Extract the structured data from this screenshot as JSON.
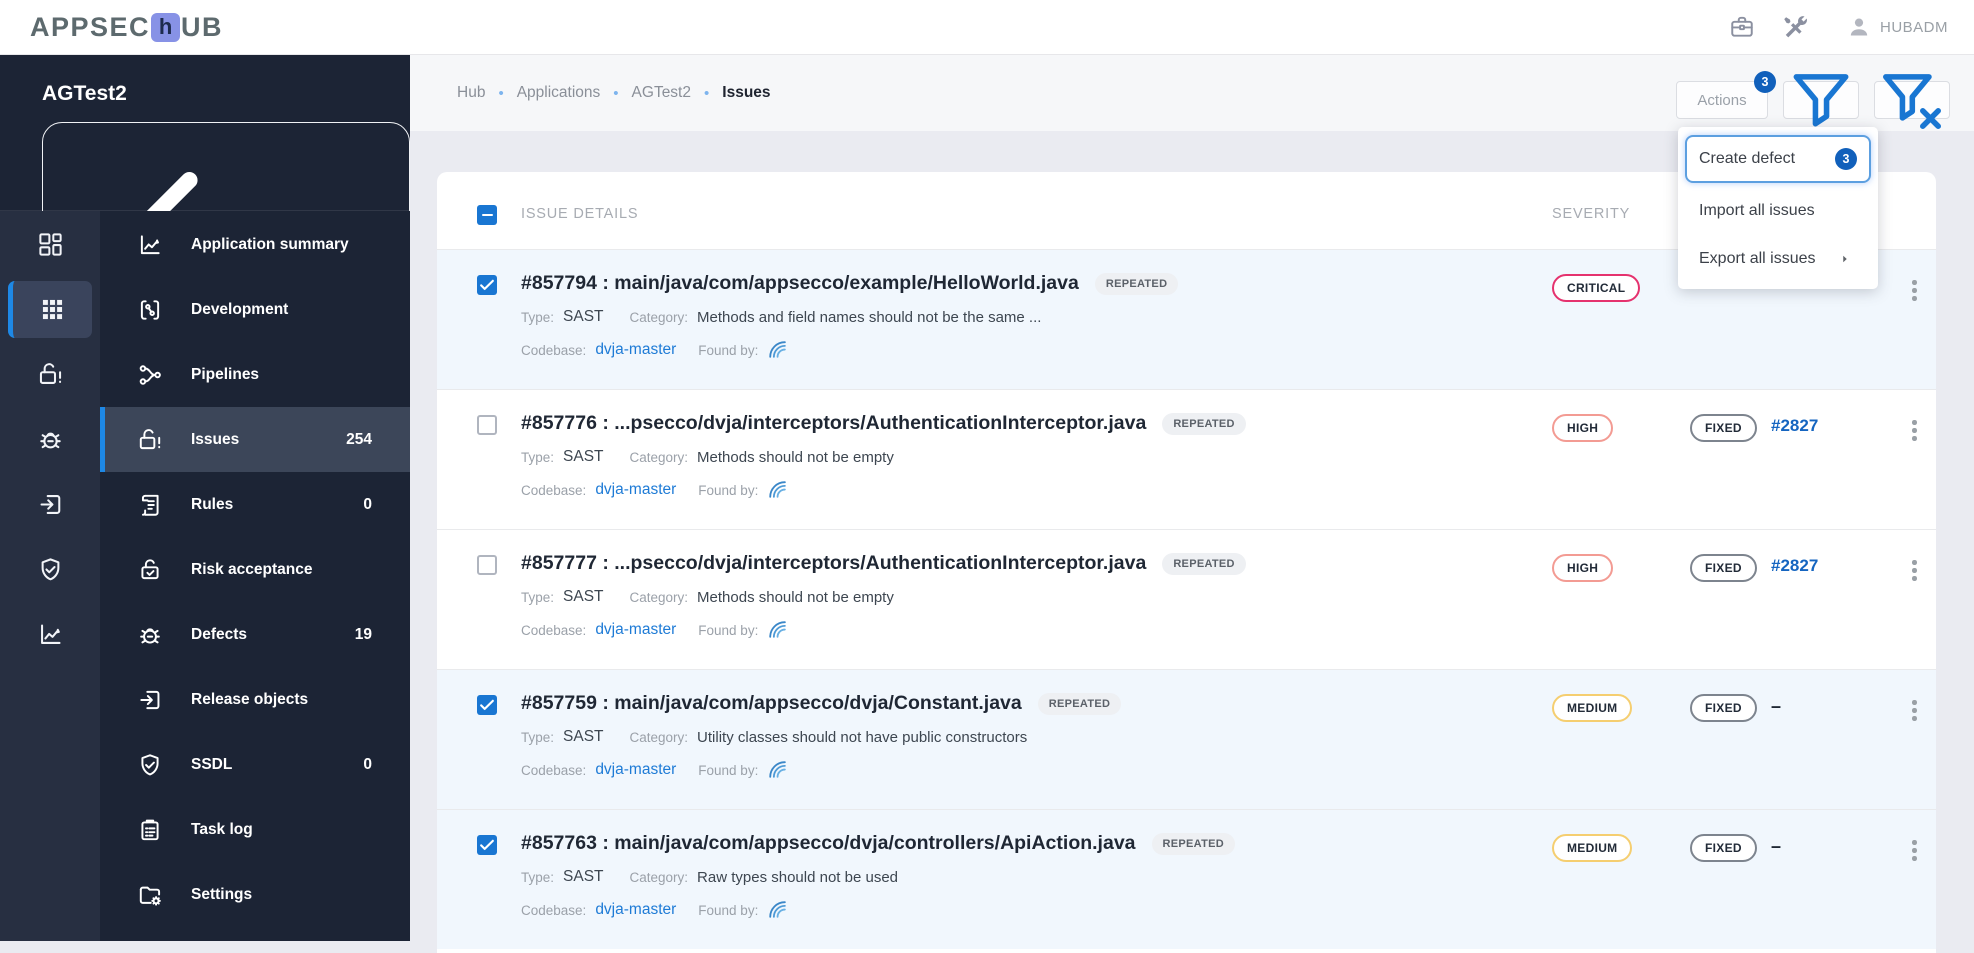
{
  "header": {
    "logo_prefix": "APPSEC",
    "logo_h": "h",
    "logo_suffix": "UB",
    "user": "HUBADM"
  },
  "sidebar": {
    "app_name": "AGTest2",
    "back_button": "Go back to applications",
    "rail": [
      {
        "name": "dashboard",
        "icon": "dashboard-grid",
        "active": false
      },
      {
        "name": "applications",
        "icon": "apps-grid",
        "active": true
      },
      {
        "name": "issues",
        "icon": "lock-alert",
        "active": false
      },
      {
        "name": "defects",
        "icon": "bug",
        "active": false
      },
      {
        "name": "release-objects",
        "icon": "exit-to-app",
        "active": false
      },
      {
        "name": "ssdl",
        "icon": "shield-check",
        "active": false
      },
      {
        "name": "reports",
        "icon": "chart",
        "active": false
      }
    ],
    "menu": [
      {
        "label": "Application summary",
        "icon": "chart-line",
        "count": "",
        "active": false
      },
      {
        "label": "Development",
        "icon": "dev-brackets",
        "count": "",
        "active": false
      },
      {
        "label": "Pipelines",
        "icon": "pipeline-branch",
        "count": "",
        "active": false
      },
      {
        "label": "Issues",
        "icon": "lock-alert",
        "count": "254",
        "active": true
      },
      {
        "label": "Rules",
        "icon": "rules-scroll",
        "count": "0",
        "active": false
      },
      {
        "label": "Risk acceptance",
        "icon": "lock-check",
        "count": "",
        "active": false
      },
      {
        "label": "Defects",
        "icon": "bug",
        "count": "19",
        "active": false
      },
      {
        "label": "Release objects",
        "icon": "exit-to-app",
        "count": "",
        "active": false
      },
      {
        "label": "SSDL",
        "icon": "shield-check",
        "count": "0",
        "active": false
      },
      {
        "label": "Task log",
        "icon": "clipboard-list",
        "count": "",
        "active": false
      },
      {
        "label": "Settings",
        "icon": "folder-gear",
        "count": "",
        "active": false
      }
    ]
  },
  "breadcrumb": [
    "Hub",
    "Applications",
    "AGTest2",
    "Issues"
  ],
  "toolbar": {
    "actions_label": "Actions",
    "actions_badge": "3"
  },
  "dropdown": {
    "items": [
      {
        "label": "Create defect",
        "badge": "3",
        "highlighted": true,
        "has_submenu": false
      },
      {
        "label": "Import all issues",
        "badge": "",
        "highlighted": false,
        "has_submenu": false
      },
      {
        "label": "Export all issues",
        "badge": "",
        "highlighted": false,
        "has_submenu": true
      }
    ]
  },
  "table": {
    "select_all_state": "indeterminate",
    "details_header": "ISSUE DETAILS",
    "severity_header": "SEVERITY",
    "labels": {
      "type": "Type:",
      "category": "Category:",
      "codebase": "Codebase:",
      "found_by": "Found by:"
    },
    "rows": [
      {
        "id": "#857794",
        "path": "main/java/com/appsecco/example/HelloWorld.java",
        "tag": "REPEATED",
        "type": "SAST",
        "category": "Methods and field names should not be the same ...",
        "codebase": "dvja-master",
        "severity": "CRITICAL",
        "status": "",
        "defect": "",
        "checked": true
      },
      {
        "id": "#857776",
        "path": "...psecco/dvja/interceptors/AuthenticationInterceptor.java",
        "tag": "REPEATED",
        "type": "SAST",
        "category": "Methods should not be empty",
        "codebase": "dvja-master",
        "severity": "HIGH",
        "status": "FIXED",
        "defect": "#2827",
        "checked": false
      },
      {
        "id": "#857777",
        "path": "...psecco/dvja/interceptors/AuthenticationInterceptor.java",
        "tag": "REPEATED",
        "type": "SAST",
        "category": "Methods should not be empty",
        "codebase": "dvja-master",
        "severity": "HIGH",
        "status": "FIXED",
        "defect": "#2827",
        "checked": false
      },
      {
        "id": "#857759",
        "path": "main/java/com/appsecco/dvja/Constant.java",
        "tag": "REPEATED",
        "type": "SAST",
        "category": "Utility classes should not have public constructors",
        "codebase": "dvja-master",
        "severity": "MEDIUM",
        "status": "FIXED",
        "defect": "–",
        "checked": true
      },
      {
        "id": "#857763",
        "path": "main/java/com/appsecco/dvja/controllers/ApiAction.java",
        "tag": "REPEATED",
        "type": "SAST",
        "category": "Raw types should not be used",
        "codebase": "dvja-master",
        "severity": "MEDIUM",
        "status": "FIXED",
        "defect": "–",
        "checked": true
      }
    ]
  },
  "colors": {
    "accent_blue": "#1976d2",
    "badge_blue": "#1160bb",
    "link": "#1565c0",
    "severity": {
      "CRITICAL": "#e5326e",
      "HIGH": "#f39b93",
      "MEDIUM": "#f5ce70"
    },
    "status_fixed_border": "#7d848e",
    "selected_row_bg": "#f1f7fd",
    "sidebar_bg": "#1c2435",
    "rail_bg": "#272f41",
    "active_item_bg": "#3c4659"
  }
}
